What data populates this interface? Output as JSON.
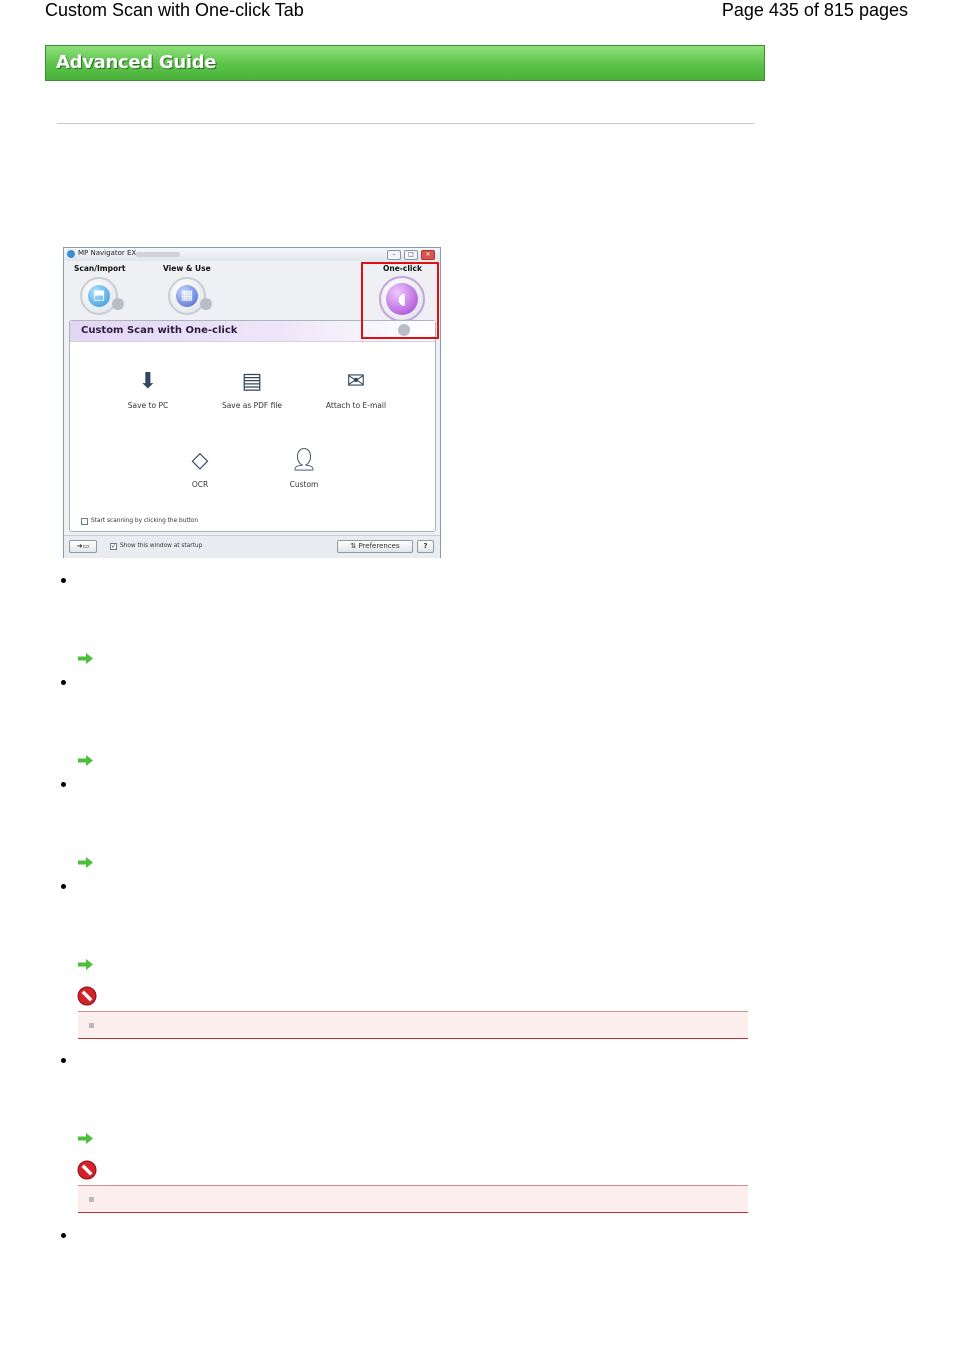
{
  "header": {
    "title": "Custom Scan with One-click Tab",
    "page_info": "Page 435 of 815 pages"
  },
  "banner": {
    "label": "Advanced Guide"
  },
  "screenshot": {
    "window_title": "MP Navigator EX",
    "tabs": [
      {
        "label": "Scan/Import",
        "icon": "scanner-icon"
      },
      {
        "label": "View & Use",
        "icon": "calendar-icon"
      },
      {
        "label": "One-click",
        "icon": "mouse-icon",
        "selected": true
      }
    ],
    "panel_title": "Custom Scan with One-click",
    "options": [
      {
        "label": "Save to PC",
        "icon": "save-to-pc-icon"
      },
      {
        "label": "Save as PDF file",
        "icon": "pdf-icon"
      },
      {
        "label": "Attach to E-mail",
        "icon": "mail-icon"
      },
      {
        "label": "OCR",
        "icon": "ocr-icon"
      },
      {
        "label": "Custom",
        "icon": "person-icon"
      }
    ],
    "start_scanning_label": "Start scanning by clicking the button",
    "start_scanning_checked": false,
    "show_window_label": "Show this window at startup",
    "show_window_checked": true,
    "preferences_label": "Preferences",
    "help_label": "?",
    "highlight_color": "#e01010"
  },
  "colors": {
    "banner_green": "#5cc24a",
    "arrow_green": "#4cbf3a",
    "note_bg": "#fdeeee",
    "note_border": "#b33333"
  }
}
